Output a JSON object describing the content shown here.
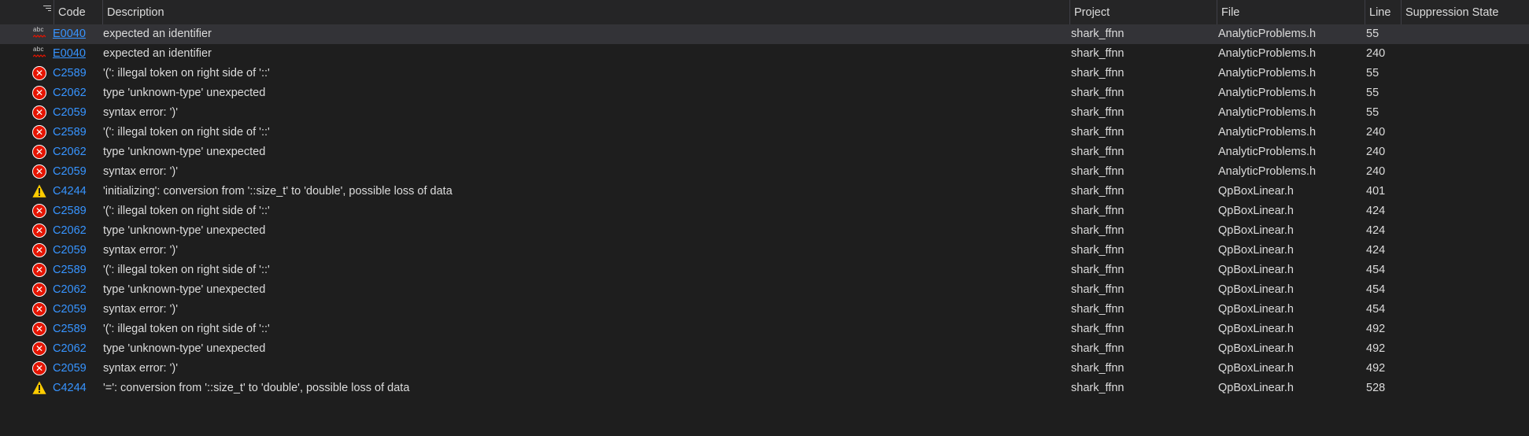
{
  "headers": {
    "code": "Code",
    "description": "Description",
    "project": "Project",
    "file": "File",
    "line": "Line",
    "suppression": "Suppression State"
  },
  "rows": [
    {
      "icon": "spell",
      "code": "E0040",
      "description": "expected an identifier",
      "project": "shark_ffnn",
      "file": "AnalyticProblems.h",
      "line": "55",
      "selected": true
    },
    {
      "icon": "spell",
      "code": "E0040",
      "description": "expected an identifier",
      "project": "shark_ffnn",
      "file": "AnalyticProblems.h",
      "line": "240"
    },
    {
      "icon": "error",
      "code": "C2589",
      "description": "'(': illegal token on right side of '::'",
      "project": "shark_ffnn",
      "file": "AnalyticProblems.h",
      "line": "55"
    },
    {
      "icon": "error",
      "code": "C2062",
      "description": "type 'unknown-type' unexpected",
      "project": "shark_ffnn",
      "file": "AnalyticProblems.h",
      "line": "55"
    },
    {
      "icon": "error",
      "code": "C2059",
      "description": "syntax error: ')'",
      "project": "shark_ffnn",
      "file": "AnalyticProblems.h",
      "line": "55"
    },
    {
      "icon": "error",
      "code": "C2589",
      "description": "'(': illegal token on right side of '::'",
      "project": "shark_ffnn",
      "file": "AnalyticProblems.h",
      "line": "240"
    },
    {
      "icon": "error",
      "code": "C2062",
      "description": "type 'unknown-type' unexpected",
      "project": "shark_ffnn",
      "file": "AnalyticProblems.h",
      "line": "240"
    },
    {
      "icon": "error",
      "code": "C2059",
      "description": "syntax error: ')'",
      "project": "shark_ffnn",
      "file": "AnalyticProblems.h",
      "line": "240"
    },
    {
      "icon": "warning",
      "code": "C4244",
      "description": "'initializing': conversion from '::size_t' to 'double', possible loss of data",
      "project": "shark_ffnn",
      "file": "QpBoxLinear.h",
      "line": "401"
    },
    {
      "icon": "error",
      "code": "C2589",
      "description": "'(': illegal token on right side of '::'",
      "project": "shark_ffnn",
      "file": "QpBoxLinear.h",
      "line": "424"
    },
    {
      "icon": "error",
      "code": "C2062",
      "description": "type 'unknown-type' unexpected",
      "project": "shark_ffnn",
      "file": "QpBoxLinear.h",
      "line": "424"
    },
    {
      "icon": "error",
      "code": "C2059",
      "description": "syntax error: ')'",
      "project": "shark_ffnn",
      "file": "QpBoxLinear.h",
      "line": "424"
    },
    {
      "icon": "error",
      "code": "C2589",
      "description": "'(': illegal token on right side of '::'",
      "project": "shark_ffnn",
      "file": "QpBoxLinear.h",
      "line": "454"
    },
    {
      "icon": "error",
      "code": "C2062",
      "description": "type 'unknown-type' unexpected",
      "project": "shark_ffnn",
      "file": "QpBoxLinear.h",
      "line": "454"
    },
    {
      "icon": "error",
      "code": "C2059",
      "description": "syntax error: ')'",
      "project": "shark_ffnn",
      "file": "QpBoxLinear.h",
      "line": "454"
    },
    {
      "icon": "error",
      "code": "C2589",
      "description": "'(': illegal token on right side of '::'",
      "project": "shark_ffnn",
      "file": "QpBoxLinear.h",
      "line": "492"
    },
    {
      "icon": "error",
      "code": "C2062",
      "description": "type 'unknown-type' unexpected",
      "project": "shark_ffnn",
      "file": "QpBoxLinear.h",
      "line": "492"
    },
    {
      "icon": "error",
      "code": "C2059",
      "description": "syntax error: ')'",
      "project": "shark_ffnn",
      "file": "QpBoxLinear.h",
      "line": "492"
    },
    {
      "icon": "warning",
      "code": "C4244",
      "description": "'=': conversion from '::size_t' to 'double', possible loss of data",
      "project": "shark_ffnn",
      "file": "QpBoxLinear.h",
      "line": "528"
    }
  ],
  "colors": {
    "background": "#1e1e1e",
    "header": "#252526",
    "selected_row": "#333337",
    "link": "#3794ff",
    "error": "#e51400",
    "warning": "#ffcc00"
  }
}
